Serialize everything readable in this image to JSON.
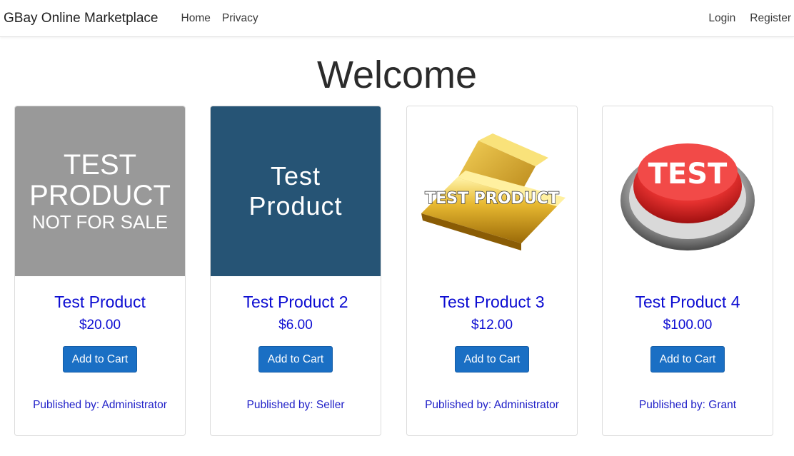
{
  "navbar": {
    "brand": "GBay Online Marketplace",
    "links": [
      "Home",
      "Privacy"
    ],
    "auth": [
      "Login",
      "Register"
    ]
  },
  "hero": {
    "title": "Welcome"
  },
  "products": [
    {
      "image_text": [
        "TEST",
        "PRODUCT",
        "NOT FOR SALE"
      ],
      "title": "Test Product",
      "price": "$20.00",
      "button": "Add to Cart",
      "publisher": "Published by: Administrator"
    },
    {
      "image_text": [
        "Test",
        "Product"
      ],
      "title": "Test Product 2",
      "price": "$6.00",
      "button": "Add to Cart",
      "publisher": "Published by: Seller"
    },
    {
      "image_text": [
        "TEST PRODUCT"
      ],
      "title": "Test Product 3",
      "price": "$12.00",
      "button": "Add to Cart",
      "publisher": "Published by: Administrator"
    },
    {
      "image_text": [
        "TEST"
      ],
      "title": "Test Product 4",
      "price": "$100.00",
      "button": "Add to Cart",
      "publisher": "Published by: Grant"
    }
  ],
  "colors": {
    "link_blue": "#0d0dd2",
    "button_blue": "#1a6fc4",
    "placeholder_gray": "#999999",
    "placeholder_navy": "#265475",
    "gold": "#d9a81e",
    "button_red": "#e5312f"
  }
}
